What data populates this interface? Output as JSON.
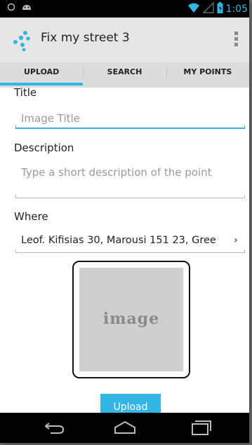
{
  "status_bar": {
    "time": "1:05",
    "icons": [
      "circle-icon",
      "android-icon",
      "wifi-icon",
      "signal-icon",
      "battery-icon"
    ]
  },
  "action_bar": {
    "title": "Fix my street 3",
    "icons": [
      "app-logo-icon",
      "overflow-menu-icon"
    ]
  },
  "tabs": [
    {
      "label": "UPLOAD",
      "active": true
    },
    {
      "label": "SEARCH",
      "active": false
    },
    {
      "label": "MY POINTS",
      "active": false
    }
  ],
  "form": {
    "title_label": "Title",
    "title_placeholder": "Image Title",
    "description_label": "Description",
    "description_placeholder": "Type a short description of the point",
    "where_label": "Where",
    "where_value_parts": [
      "Leof.",
      " ",
      "Kifisias",
      " 30, ",
      "Marousi",
      " 151 23, Gree"
    ],
    "where_arrow": "›",
    "image_placeholder_text": "image",
    "upload_label": "Upload"
  },
  "nav_bar": {
    "icons": [
      "back-icon",
      "home-icon",
      "recents-icon"
    ]
  },
  "colors": {
    "accent": "#33b5e5",
    "action_bar": "#e6e6e6",
    "tab_bar": "#dcdcdc",
    "image_placeholder": "#cfcfcf"
  }
}
